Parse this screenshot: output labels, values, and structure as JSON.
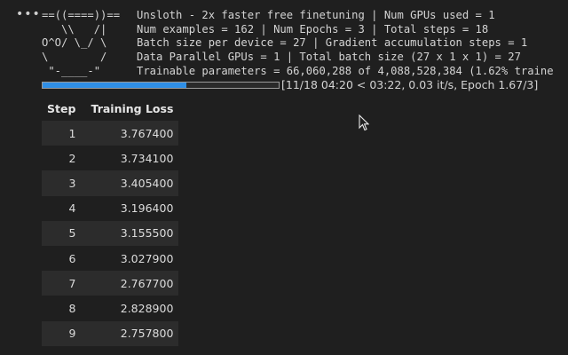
{
  "cell": {
    "menu_glyph": "•••"
  },
  "banner": {
    "lines": [
      {
        "art": "==((====))==",
        "text": "Unsloth - 2x faster free finetuning | Num GPUs used = 1"
      },
      {
        "art": "   \\\\   /|",
        "text": "Num examples = 162 | Num Epochs = 3 | Total steps = 18"
      },
      {
        "art": "O^O/ \\_/ \\",
        "text": "Batch size per device = 27 | Gradient accumulation steps = 1"
      },
      {
        "art": "\\        /",
        "text": "Data Parallel GPUs = 1 | Total batch size (27 x 1 x 1) = 27"
      },
      {
        "art": " \"-____-\"",
        "text": "Trainable parameters = 66,060,288 of 4,088,528,384 (1.62% traine"
      }
    ]
  },
  "progress": {
    "fraction": 0.61,
    "text": "[11/18 04:20 < 03:22, 0.03 it/s, Epoch 1.67/3]"
  },
  "table": {
    "headers": [
      "Step",
      "Training Loss"
    ],
    "rows": [
      [
        "1",
        "3.767400"
      ],
      [
        "2",
        "3.734100"
      ],
      [
        "3",
        "3.405400"
      ],
      [
        "4",
        "3.196400"
      ],
      [
        "5",
        "3.155500"
      ],
      [
        "6",
        "3.027900"
      ],
      [
        "7",
        "2.767700"
      ],
      [
        "8",
        "2.828900"
      ],
      [
        "9",
        "2.757800"
      ]
    ]
  },
  "colors": {
    "background": "#1f1f1f",
    "progress_fill": "#2f8fe6",
    "row_stripe": "#2c2c2c"
  }
}
